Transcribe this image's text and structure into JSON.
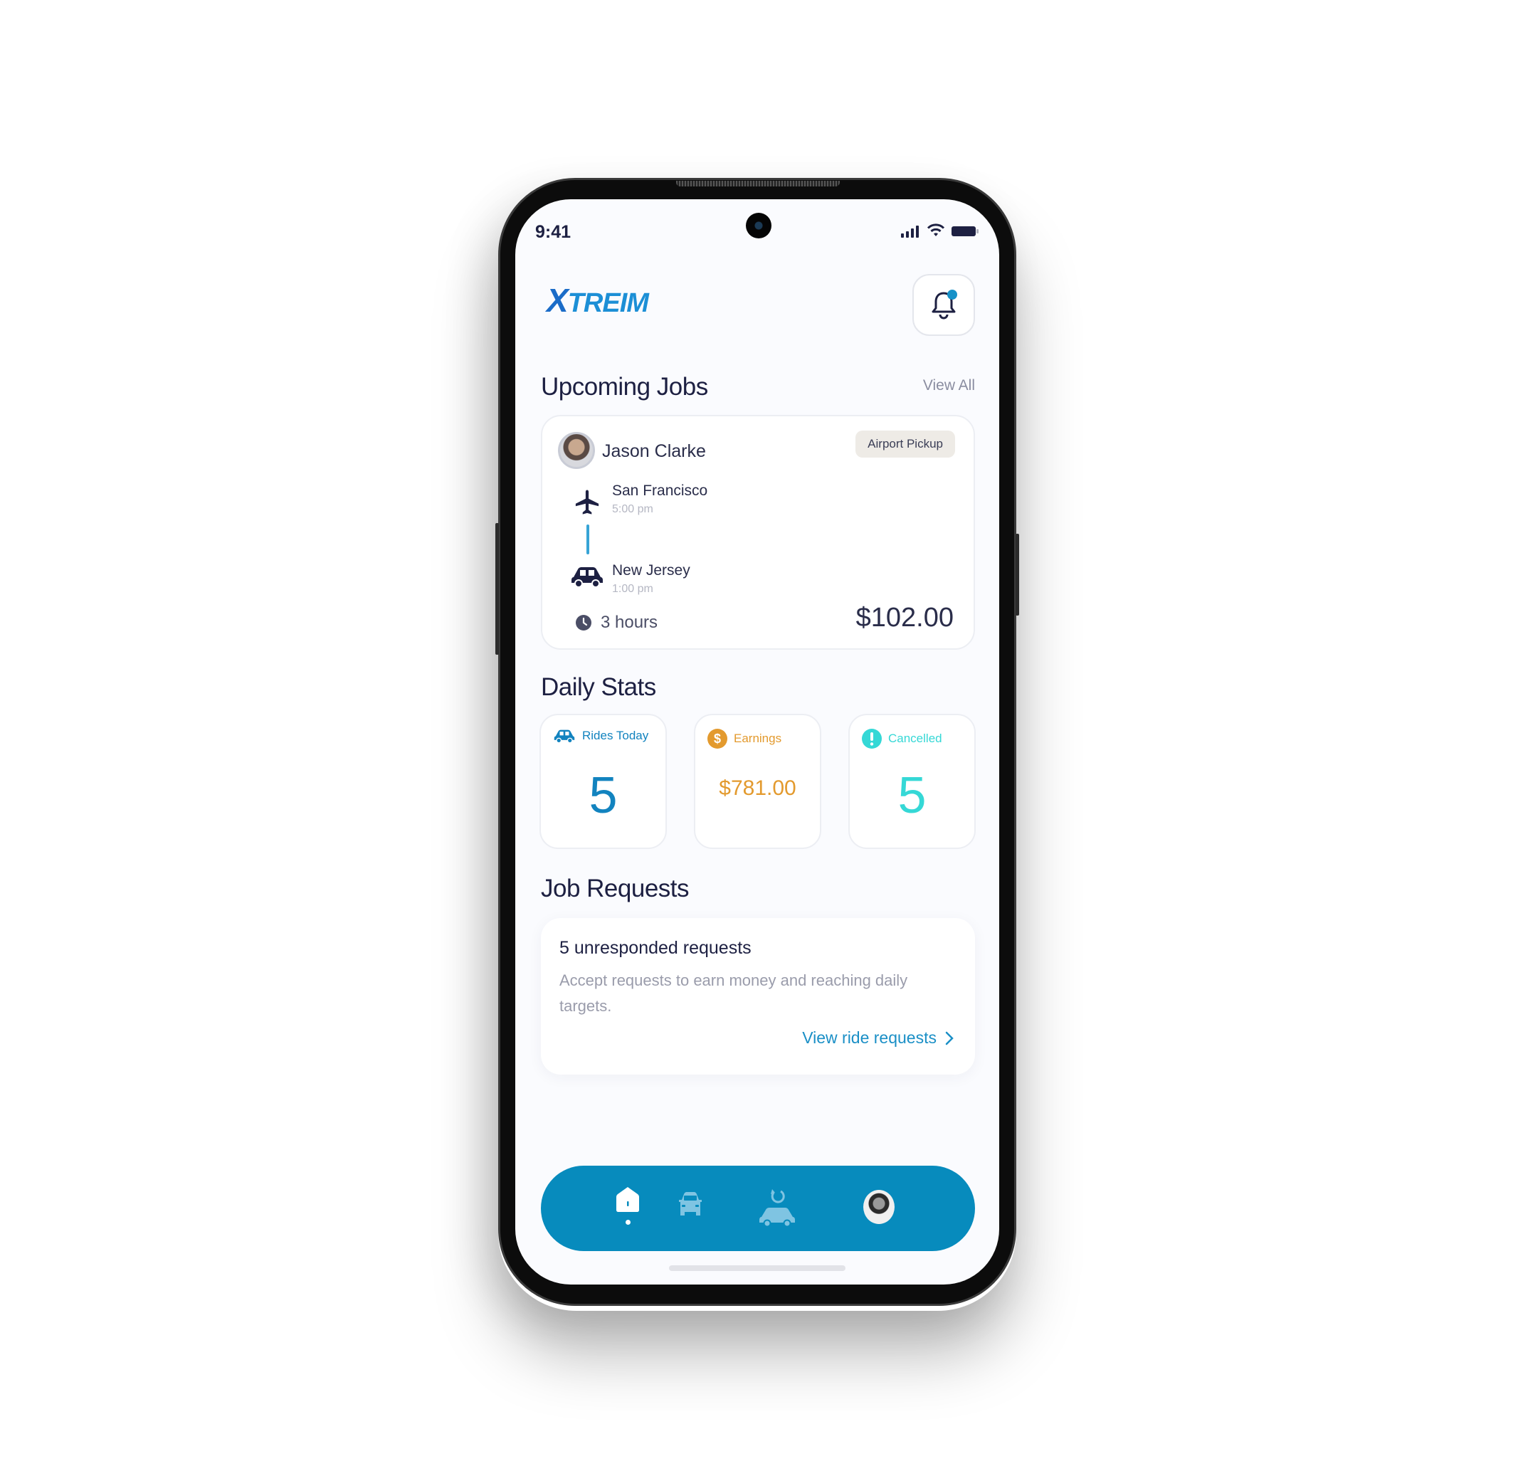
{
  "status_bar": {
    "time": "9:41"
  },
  "header": {
    "logo_x": "X",
    "logo_rest": "TREIM"
  },
  "upcoming_jobs": {
    "title": "Upcoming Jobs",
    "view_all": "View All",
    "job": {
      "customer": "Jason Clarke",
      "tag": "Airport Pickup",
      "pickup": {
        "place": "San Francisco",
        "time": "5:00 pm"
      },
      "dropoff": {
        "place": "New Jersey",
        "time": "1:00 pm"
      },
      "duration": "3 hours",
      "price": "$102.00"
    }
  },
  "daily_stats": {
    "title": "Daily Stats",
    "cards": [
      {
        "label": "Rides Today",
        "value": "5",
        "color": "#1283bf"
      },
      {
        "label": "Earnings",
        "value": "$781.00",
        "color": "#e39a2e"
      },
      {
        "label": "Cancelled",
        "value": "5",
        "color": "#35d8d6"
      }
    ]
  },
  "job_requests": {
    "title": "Job Requests",
    "heading": "5 unresponded requests",
    "description": "Accept requests to earn money and reaching daily targets.",
    "link": "View ride requests"
  },
  "nav": {
    "items": [
      "home",
      "rides",
      "ride-history",
      "profile"
    ],
    "active": "home",
    "color": "#078bbd"
  }
}
